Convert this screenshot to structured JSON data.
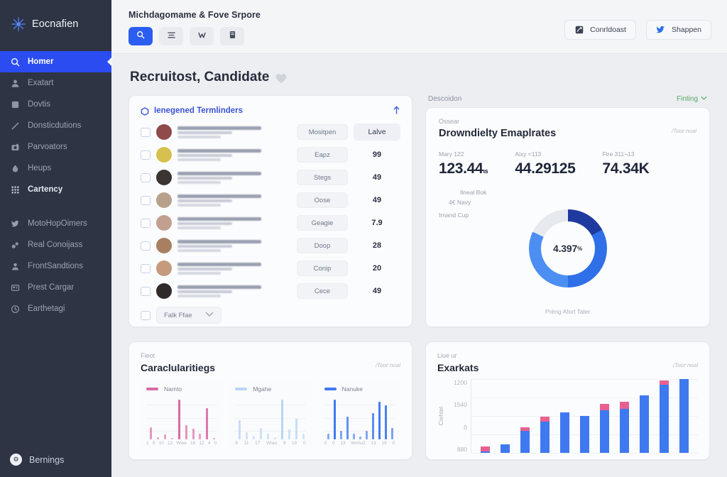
{
  "brand": {
    "name": "Eocnafien",
    "logo_icon": "starburst-logo-icon"
  },
  "sidebar": {
    "items": [
      {
        "label": "Homer",
        "icon": "search-icon",
        "active": true
      },
      {
        "label": "Exatart",
        "icon": "user-icon",
        "active": false
      },
      {
        "label": "Dovtis",
        "icon": "square-icon",
        "active": false
      },
      {
        "label": "Donsticdutions",
        "icon": "pencil-icon",
        "active": false
      },
      {
        "label": "Parvoators",
        "icon": "camera-icon",
        "active": false
      },
      {
        "label": "Heups",
        "icon": "droplet-icon",
        "active": false
      },
      {
        "label": "Cartency",
        "icon": "grid-icon",
        "active": false,
        "bold": true
      }
    ],
    "items2": [
      {
        "label": "MotoHopOimers",
        "icon": "twitter-bird-icon"
      },
      {
        "label": "Real Conoijass",
        "icon": "link-icon"
      },
      {
        "label": "FrontSandtions",
        "icon": "person-icon"
      },
      {
        "label": "Prest Cargar",
        "icon": "card-icon"
      },
      {
        "label": "Earthetagi",
        "icon": "clock-icon"
      }
    ],
    "bottom": {
      "label": "Bernings",
      "icon": "gear-icon"
    }
  },
  "topbar": {
    "title": "Michdagomame & Fove Srpore",
    "tools": [
      {
        "name": "search-tool",
        "icon": "search-icon",
        "primary": true
      },
      {
        "name": "list-tool",
        "icon": "list-lines-icon",
        "primary": false
      },
      {
        "name": "filter-tool",
        "icon": "filter-w-icon",
        "primary": false
      },
      {
        "name": "doc-tool",
        "icon": "document-icon",
        "primary": false
      }
    ],
    "actions": [
      {
        "label": "Conrldoast",
        "icon": "chart-square-icon"
      },
      {
        "label": "Shappen",
        "icon": "twitter-bird-icon"
      }
    ]
  },
  "page": {
    "title": "Recruitost, Candidate",
    "title_icon": "heart-icon"
  },
  "list_card": {
    "title": "Ienegened Termlinders",
    "title_icon": "hexagon-icon",
    "collapse_icon": "arrow-up-icon",
    "rows": [
      {
        "tag": "Mositpen",
        "metric": "Lalve",
        "is_badge": true,
        "avatar": "#8f4a4a"
      },
      {
        "tag": "Eapz",
        "metric": "99",
        "is_badge": false,
        "avatar": "#d7c14e"
      },
      {
        "tag": "Stegs",
        "metric": "49",
        "is_badge": false,
        "avatar": "#3a3432"
      },
      {
        "tag": "Oose",
        "metric": "49",
        "is_badge": false,
        "avatar": "#b8a18c"
      },
      {
        "tag": "Geagie",
        "metric": "7.9",
        "is_badge": false,
        "avatar": "#c2a091"
      },
      {
        "tag": "Doop",
        "metric": "28",
        "is_badge": false,
        "avatar": "#a97f62"
      },
      {
        "tag": "Conip",
        "metric": "20",
        "is_badge": false,
        "avatar": "#c59a7d"
      },
      {
        "tag": "Cece",
        "metric": "49",
        "is_badge": false,
        "avatar": "#2f2b2a"
      }
    ],
    "footer_dropdown": {
      "label": "Falk Ffae",
      "icon": "chevron-down-icon"
    }
  },
  "stats": {
    "section_label": "Descoidon",
    "filter_link": {
      "label": "Finting",
      "icon": "chevron-down-icon",
      "color": "#58a763"
    },
    "eyebrow": "Ossear",
    "title": "Drowndielty Emaplrates",
    "corner_note": "/Toor noal",
    "kpis": [
      {
        "label": "Mary 122",
        "value": "123.44",
        "suffix": "ıs"
      },
      {
        "label": "Aixy <113",
        "value": "44.29125",
        "suffix": ""
      },
      {
        "label": "Fire 311¬13",
        "value": "74.34K",
        "suffix": ""
      }
    ],
    "donut": {
      "center_value": "4.397",
      "center_suffix": "%",
      "caption": "Préng Afort Taler",
      "labels": [
        "Ilneal Bok",
        "4€ Navy",
        "Irnand Cup"
      ],
      "segments": [
        {
          "name": "navy",
          "color": "#1f3a9e",
          "pct": 17
        },
        {
          "name": "blue",
          "color": "#2f6fe8",
          "pct": 33
        },
        {
          "name": "light",
          "color": "#4c8ef2",
          "pct": 32
        },
        {
          "name": "gray",
          "color": "#e6e9ee",
          "pct": 18
        }
      ]
    }
  },
  "chart_data": [
    {
      "type": "bar",
      "card_eyebrow": "Fieot",
      "title": "Caraclularitiegs",
      "corner_note": "/Toor noal",
      "panels": [
        {
          "legend": "Namto",
          "color": "#d96aa2",
          "x": [
            "1",
            "9",
            "10",
            "12",
            "Wwe",
            "16",
            "12",
            "4",
            "0"
          ],
          "values": [
            22,
            4,
            9,
            3,
            74,
            26,
            20,
            11,
            58,
            3
          ]
        },
        {
          "legend": "Mgahe",
          "color": "#b9d4f6",
          "x": [
            "8",
            "11",
            "17",
            "Wiao",
            "9",
            "19",
            "0"
          ],
          "values": [
            30,
            11,
            6,
            18,
            9,
            3,
            62,
            16,
            32,
            9
          ]
        },
        {
          "legend": "Nanuke",
          "color": "#3f79f0",
          "x": [
            "0",
            "0",
            "13",
            "Wo0u2",
            "13",
            "19",
            "0"
          ],
          "values": [
            6,
            42,
            9,
            24,
            6,
            3,
            9,
            28,
            40,
            36,
            12
          ]
        }
      ]
    },
    {
      "type": "bar",
      "card_eyebrow": "Liue ur",
      "title": "Exarkats",
      "corner_note": "/Toor noal",
      "ylabel": "Ciehtel",
      "yticks": [
        "1200",
        "1540",
        "0",
        "880"
      ],
      "series": [
        {
          "name": "blue",
          "color": "#3f79f0",
          "values": [
            2,
            12,
            30,
            42,
            55,
            50,
            58,
            60,
            78,
            92,
            100
          ]
        },
        {
          "name": "pink",
          "color": "#e9608f",
          "values": [
            7,
            0,
            5,
            7,
            0,
            0,
            8,
            9,
            0,
            6,
            0
          ]
        }
      ]
    }
  ]
}
